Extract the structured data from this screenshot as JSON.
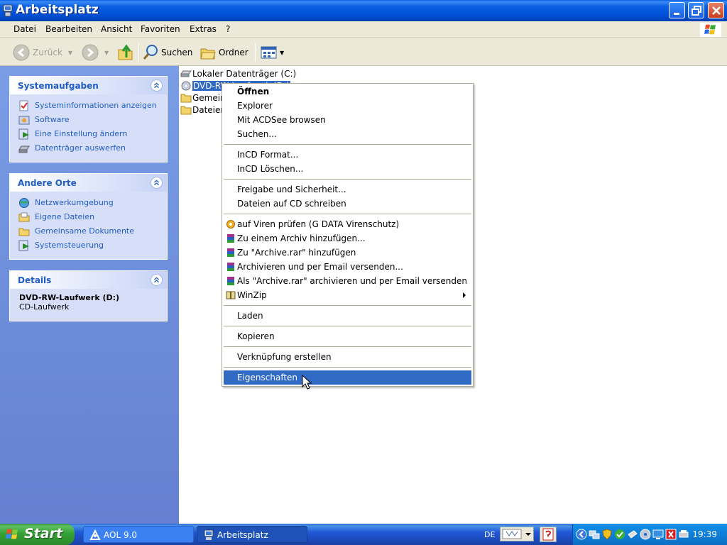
{
  "window": {
    "title": "Arbeitsplatz"
  },
  "menubar": {
    "items": [
      "Datei",
      "Bearbeiten",
      "Ansicht",
      "Favoriten",
      "Extras",
      "?"
    ]
  },
  "toolbar": {
    "back_label": "Zurück",
    "search_label": "Suchen",
    "folders_label": "Ordner"
  },
  "taskpane": {
    "system": {
      "title": "Systemaufgaben",
      "links": [
        "Systeminformationen anzeigen",
        "Software",
        "Eine Einstellung ändern",
        "Datenträger auswerfen"
      ]
    },
    "places": {
      "title": "Andere Orte",
      "links": [
        "Netzwerkumgebung",
        "Eigene Dateien",
        "Gemeinsame Dokumente",
        "Systemsteuerung"
      ]
    },
    "details": {
      "title": "Details",
      "name": "DVD-RW-Laufwerk (D:)",
      "type": "CD-Laufwerk"
    }
  },
  "files": [
    {
      "label": "Lokaler Datenträger (C:)",
      "icon": "hard-drive-icon"
    },
    {
      "label": "DVD-RW-Laufwerk (D:)",
      "icon": "cd-drive-icon",
      "selected": true
    },
    {
      "label": "Gemeinsame Dokumente",
      "icon": "folder-icon"
    },
    {
      "label": "Dateien",
      "icon": "folder-icon"
    }
  ],
  "context_menu": {
    "groups": [
      [
        {
          "label": "Öffnen",
          "bold": true
        },
        {
          "label": "Explorer"
        },
        {
          "label": "Mit ACDSee browsen"
        },
        {
          "label": "Suchen..."
        }
      ],
      [
        {
          "label": "InCD Format..."
        },
        {
          "label": "InCD Löschen..."
        }
      ],
      [
        {
          "label": "Freigabe und Sicherheit..."
        },
        {
          "label": "Dateien auf CD schreiben"
        }
      ],
      [
        {
          "label": "auf Viren prüfen (G DATA Virenschutz)",
          "icon": "antivirus-icon"
        },
        {
          "label": "Zu einem Archiv hinzufügen...",
          "icon": "winrar-icon"
        },
        {
          "label": "Zu \"Archive.rar\" hinzufügen",
          "icon": "winrar-icon"
        },
        {
          "label": "Archivieren und per Email versenden...",
          "icon": "winrar-icon"
        },
        {
          "label": "Als \"Archive.rar\" archivieren und per Email versenden",
          "icon": "winrar-icon"
        },
        {
          "label": "WinZip",
          "icon": "winzip-icon",
          "submenu": true
        }
      ],
      [
        {
          "label": "Laden"
        }
      ],
      [
        {
          "label": "Kopieren"
        }
      ],
      [
        {
          "label": "Verknüpfung erstellen"
        }
      ],
      [
        {
          "label": "Eigenschaften",
          "highlighted": true
        }
      ]
    ]
  },
  "taskbar": {
    "start_label": "Start",
    "tasks": [
      {
        "label": "AOL 9.0",
        "active": false
      },
      {
        "label": "Arbeitsplatz",
        "active": true
      }
    ],
    "language": "DE",
    "clock": "19:39"
  },
  "colors": {
    "selection": "#316ac5",
    "link": "#215dc6",
    "menubar_bg": "#ece9d8"
  }
}
